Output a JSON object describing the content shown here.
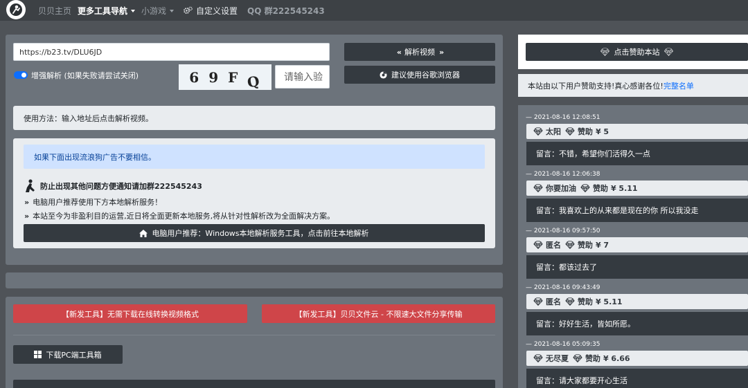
{
  "nav": {
    "home": "贝贝主页",
    "tools": "更多工具导航",
    "games": "小游戏",
    "settings": "自定义设置",
    "qq_group": "QQ 群222545243"
  },
  "parser": {
    "url_value": "https://b23.tv/DLU6JD",
    "parse_button": "解析视频",
    "browser_button": "建议使用谷歌浏览器",
    "enhanced_label": "增强解析 (如果失败请尝试关闭)",
    "captcha_chars": [
      "6",
      "9",
      "F",
      "Q"
    ],
    "captcha_placeholder": "请输入验",
    "usage": "使用方法：输入地址后点击解析视频。",
    "warning": "如果下面出现流浪狗广告不要相信。",
    "notice_qq": "防止出现其他问题方便通知请加群222545243",
    "notice_pc": "电脑用户推荐使用下方本地解析服务！",
    "notice_free": "本站至今为非盈利目的运营,近日将全面更新本地服务,将从针对性解析改为全面解决方案。",
    "local_button": "电脑用户推荐：Windows本地解析服务工具，点击前往本地解析"
  },
  "tools": {
    "convert": "【新发工具】无需下载在线转换视频格式",
    "cloud": "【新发工具】贝贝文件云 - 不限速大文件分享传输",
    "pc_toolbox": "下载PC端工具箱"
  },
  "sponsor": {
    "button": "点击赞助本站",
    "thanks_text": "本站由以下用户赞助支持!真心感谢各位!",
    "full_list_link": "完整名单",
    "donate_word": "赞助",
    "msg_prefix": "留言：",
    "donors": [
      {
        "time": "— 2021-08-16 12:08:51",
        "name": "太阳",
        "amount": "¥ 5",
        "message": "不错，希望你们活得久一点"
      },
      {
        "time": "— 2021-08-16 12:06:38",
        "name": "你要加油",
        "amount": "¥ 5.11",
        "message": "我喜欢上的从来都是现在的你 所以我没走"
      },
      {
        "time": "— 2021-08-16 09:57:50",
        "name": "匿名",
        "amount": "¥ 7",
        "message": "都该过去了"
      },
      {
        "time": "— 2021-08-16 09:43:49",
        "name": "匿名",
        "amount": "¥ 5.11",
        "message": "好好生活，皆如所愿。"
      },
      {
        "time": "— 2021-08-16 05:09:35",
        "name": "无尽夏",
        "amount": "¥ 6.66",
        "message": "请大家都要开心生活"
      }
    ]
  },
  "colors": {
    "accent_blue": "#0d6efd",
    "danger_red": "#cf4549",
    "dark": "#343a40"
  }
}
